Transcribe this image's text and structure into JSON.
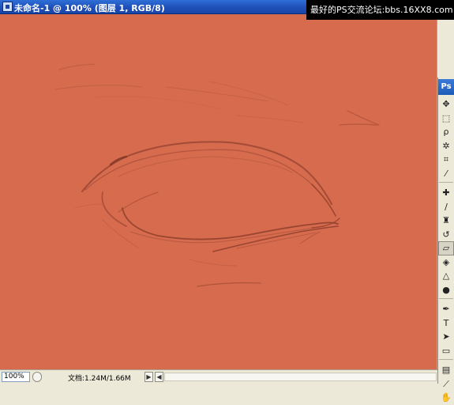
{
  "window": {
    "title": "未命名-1 @ 100% (图层 1, RGB/8)",
    "banner": "最好的PS交流论坛:bbs.16XX8.com",
    "canvas_color": "#d66b4e"
  },
  "toolbox": {
    "logo": "Ps",
    "tools": [
      {
        "name": "move-tool-icon",
        "glyph": "✥"
      },
      {
        "name": "marquee-tool-icon",
        "glyph": "⬚"
      },
      {
        "name": "lasso-tool-icon",
        "glyph": "ρ"
      },
      {
        "name": "magic-wand-tool-icon",
        "glyph": "✲"
      },
      {
        "name": "crop-tool-icon",
        "glyph": "⌗"
      },
      {
        "name": "slice-tool-icon",
        "glyph": "⁄"
      },
      {
        "name": "healing-brush-tool-icon",
        "glyph": "✚"
      },
      {
        "name": "brush-tool-icon",
        "glyph": "∕"
      },
      {
        "name": "clone-stamp-tool-icon",
        "glyph": "♜"
      },
      {
        "name": "history-brush-tool-icon",
        "glyph": "↺"
      },
      {
        "name": "eraser-tool-icon",
        "glyph": "▱"
      },
      {
        "name": "paint-bucket-tool-icon",
        "glyph": "◈"
      },
      {
        "name": "blur-tool-icon",
        "glyph": "△"
      },
      {
        "name": "dodge-tool-icon",
        "glyph": "●"
      },
      {
        "name": "pen-tool-icon",
        "glyph": "✒"
      },
      {
        "name": "type-tool-icon",
        "glyph": "T"
      },
      {
        "name": "path-selection-tool-icon",
        "glyph": "➤"
      },
      {
        "name": "shape-tool-icon",
        "glyph": "▭"
      },
      {
        "name": "notes-tool-icon",
        "glyph": "▤"
      },
      {
        "name": "eyedropper-tool-icon",
        "glyph": "⟋"
      },
      {
        "name": "hand-tool-icon",
        "glyph": "✋"
      }
    ]
  },
  "statusbar": {
    "zoom": "100%",
    "doc_info": "文档:1.24M/1.66M",
    "nav_right": "▶",
    "nav_left": "◀"
  }
}
